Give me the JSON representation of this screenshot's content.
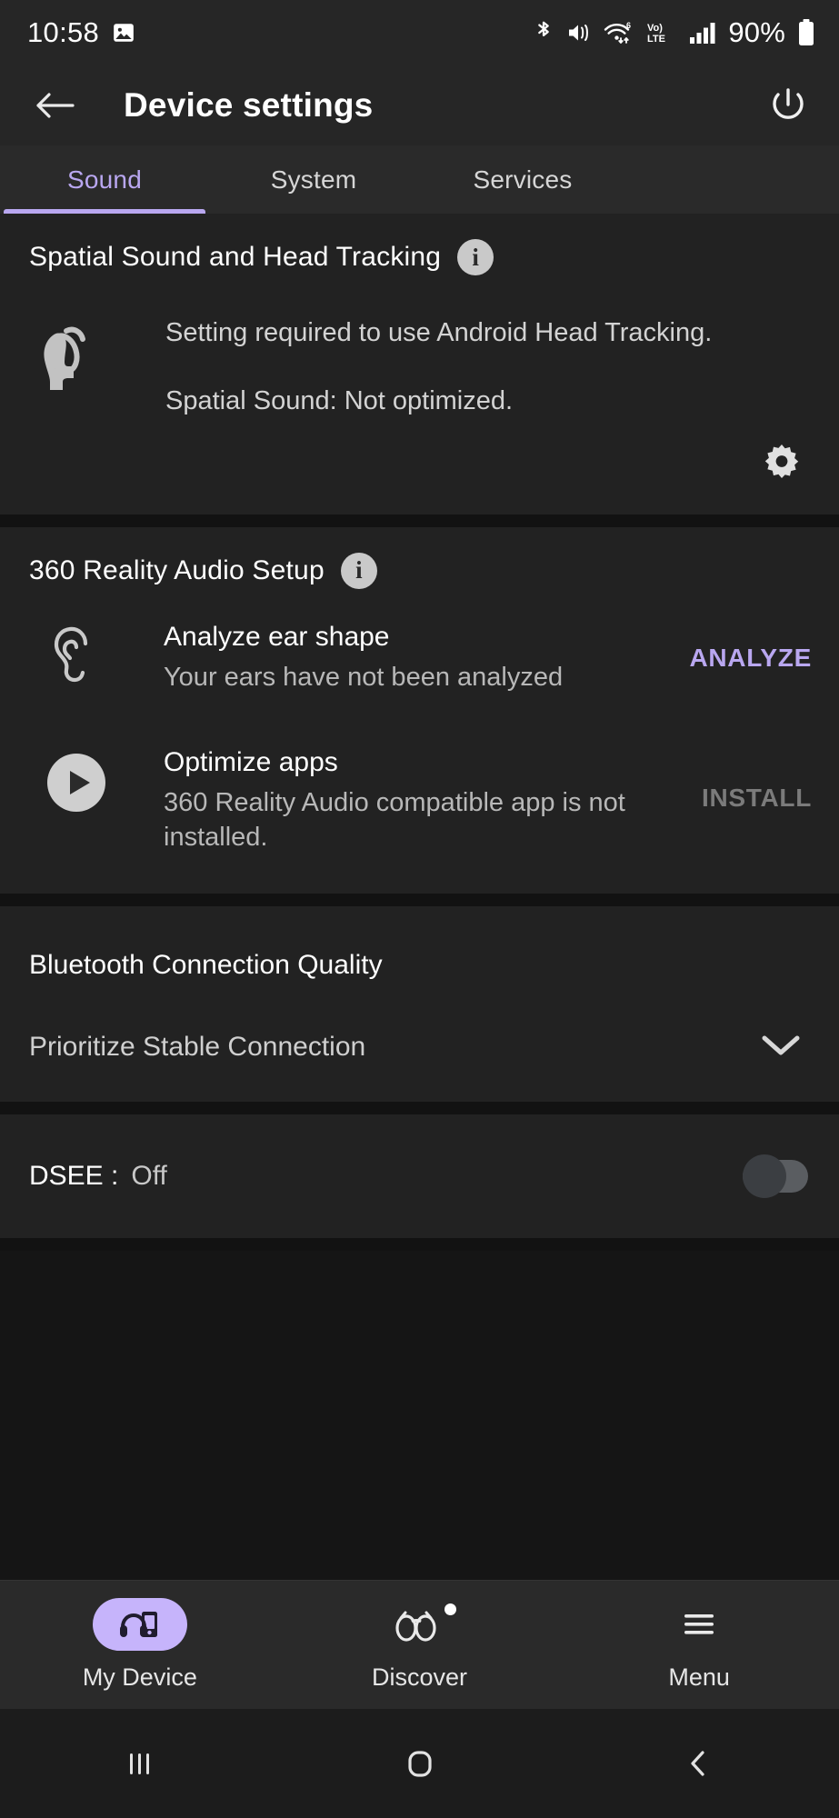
{
  "statusbar": {
    "time": "10:58",
    "battery_percent": "90%",
    "icons": [
      "image-icon",
      "bluetooth-icon",
      "mute-vibrate-icon",
      "wifi6-icon",
      "volte-icon",
      "signal-bars-icon",
      "battery-icon"
    ]
  },
  "appbar": {
    "title": "Device settings",
    "back_icon": "back-arrow-icon",
    "power_icon": "power-icon"
  },
  "tabs": [
    {
      "label": "Sound",
      "active": true
    },
    {
      "label": "System",
      "active": false
    },
    {
      "label": "Services",
      "active": false
    }
  ],
  "spatial": {
    "title": "Spatial Sound and Head Tracking",
    "info_icon": "info-icon",
    "icon": "head-tracking-icon",
    "line1": "Setting required to use Android Head Tracking.",
    "line2": "Spatial Sound: Not optimized.",
    "settings_icon": "gear-icon"
  },
  "reality360": {
    "title": "360 Reality Audio Setup",
    "info_icon": "info-icon",
    "rows": [
      {
        "icon": "ear-icon",
        "title": "Analyze ear shape",
        "subtitle": "Your ears have not been analyzed",
        "action": "ANALYZE",
        "action_enabled": true
      },
      {
        "icon": "play-circle-icon",
        "title": "Optimize apps",
        "subtitle": "360 Reality Audio compatible app is not installed.",
        "action": "INSTALL",
        "action_enabled": false
      }
    ]
  },
  "bluetooth_quality": {
    "title": "Bluetooth Connection Quality",
    "selected": "Prioritize Stable Connection",
    "chevron_icon": "chevron-down-icon"
  },
  "dsee": {
    "label": "DSEE :",
    "value": "Off",
    "enabled": false
  },
  "bottomnav": [
    {
      "label": "My Device",
      "icon": "device-headphones-icon",
      "active": true,
      "badge": false
    },
    {
      "label": "Discover",
      "icon": "binoculars-icon",
      "active": false,
      "badge": true
    },
    {
      "label": "Menu",
      "icon": "hamburger-menu-icon",
      "active": false,
      "badge": false
    }
  ],
  "sysnav": [
    {
      "icon": "recents-icon"
    },
    {
      "icon": "home-icon"
    },
    {
      "icon": "back-icon"
    }
  ],
  "colors": {
    "accent": "#b9a7f0",
    "accent_pill": "#c6b4fb",
    "card_bg": "#222222",
    "bar_bg": "#262626",
    "disabled": "#7b7b7b"
  }
}
